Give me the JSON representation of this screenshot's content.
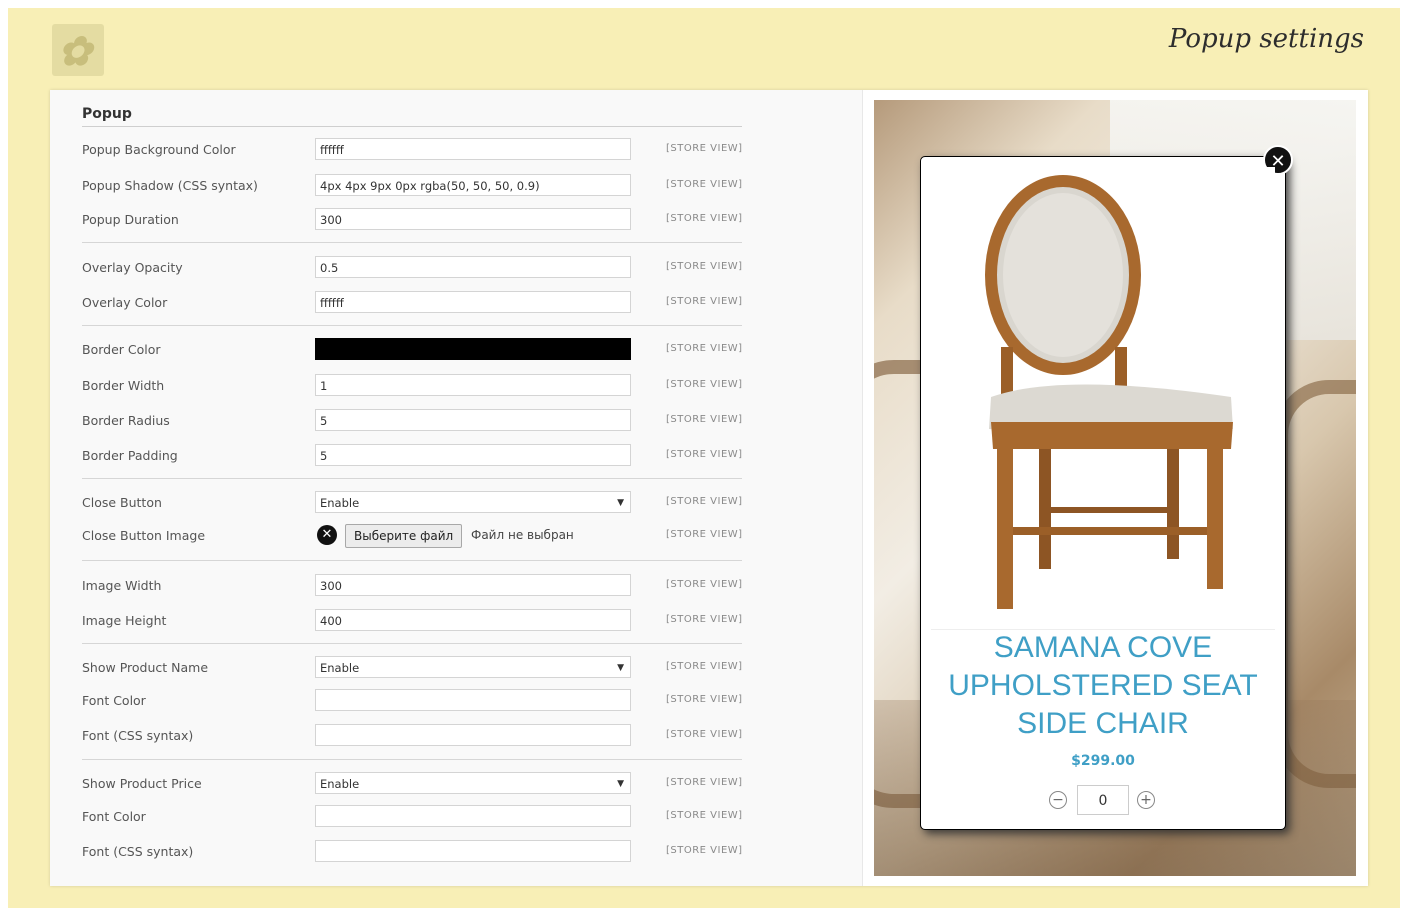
{
  "header": {
    "title": "Popup settings",
    "logo": "brand-logo"
  },
  "section": {
    "title": "Popup"
  },
  "store_view_label": "[STORE VIEW]",
  "fields": {
    "popup_bg_color": {
      "label": "Popup Background Color",
      "value": "ffffff"
    },
    "popup_shadow": {
      "label": "Popup Shadow (CSS syntax)",
      "value": "4px 4px 9px 0px rgba(50, 50, 50, 0.9)"
    },
    "popup_duration": {
      "label": "Popup Duration",
      "value": "300"
    },
    "overlay_opacity": {
      "label": "Overlay Opacity",
      "value": "0.5"
    },
    "overlay_color": {
      "label": "Overlay Color",
      "value": "ffffff"
    },
    "border_color": {
      "label": "Border Color",
      "value": "",
      "color": "#000000"
    },
    "border_width": {
      "label": "Border Width",
      "value": "1"
    },
    "border_radius": {
      "label": "Border Radius",
      "value": "5"
    },
    "border_padding": {
      "label": "Border Padding",
      "value": "5"
    },
    "close_button": {
      "label": "Close Button",
      "value": "Enable"
    },
    "close_button_image": {
      "label": "Close Button Image",
      "button": "Выберите файл",
      "filename": "Файл не выбран"
    },
    "image_width": {
      "label": "Image Width",
      "value": "300"
    },
    "image_height": {
      "label": "Image Height",
      "value": "400"
    },
    "show_product_name": {
      "label": "Show Product Name",
      "value": "Enable"
    },
    "name_font_color": {
      "label": "Font Color",
      "value": ""
    },
    "name_font": {
      "label": "Font (CSS syntax)",
      "value": ""
    },
    "show_product_price": {
      "label": "Show Product Price",
      "value": "Enable"
    },
    "price_font_color": {
      "label": "Font Color",
      "value": ""
    },
    "price_font": {
      "label": "Font (CSS syntax)",
      "value": ""
    }
  },
  "preview": {
    "product_name": "SAMANA COVE UPHOLSTERED SEAT SIDE CHAIR",
    "price": "$299.00",
    "quantity": "0",
    "close_icon": "close-icon",
    "name_color": "#3f9fc6"
  }
}
